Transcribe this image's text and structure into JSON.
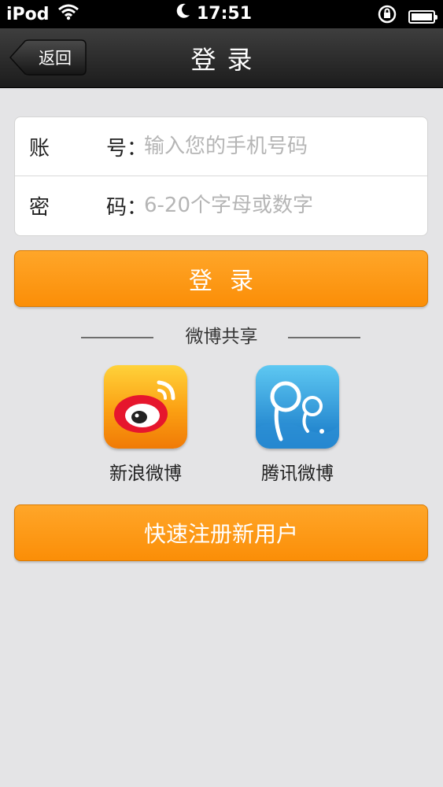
{
  "status_bar": {
    "carrier": "iPod",
    "time": "17:51"
  },
  "nav": {
    "back_label": "返回",
    "title": "登录"
  },
  "form": {
    "account_label_1": "账",
    "account_label_2": "号：",
    "account_placeholder": "输入您的手机号码",
    "password_label_1": "密",
    "password_label_2": "码：",
    "password_placeholder": "6-20个字母或数字"
  },
  "login_button": "登录",
  "share": {
    "title": "微博共享",
    "items": [
      {
        "label": "新浪微博",
        "icon": "sina-weibo-icon"
      },
      {
        "label": "腾讯微博",
        "icon": "tencent-weibo-icon"
      }
    ]
  },
  "register_button": "快速注册新用户",
  "colors": {
    "accent": "#fb9a14",
    "nav": "#2a2a2a",
    "background": "#e4e4e6"
  }
}
